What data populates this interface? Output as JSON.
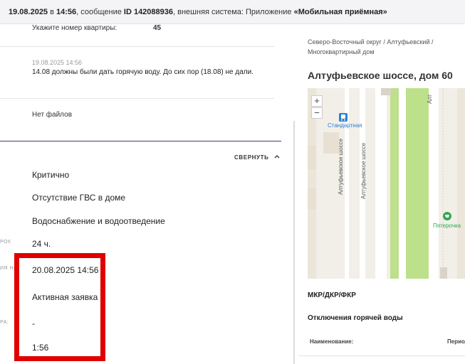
{
  "header": {
    "date": "19.08.2025",
    "in_word": " в ",
    "time": "14:56",
    "msg_prefix": ", сообщение ",
    "msg_id": "ID 142088936",
    "system_prefix": ", внешняя система: Приложение ",
    "app_name": "«Мобильная приёмная»"
  },
  "question": {
    "label": "Укажите номер квартиры:",
    "value": "45"
  },
  "comment": {
    "timestamp": "19.08.2025 14:56",
    "text": "14.08 должны были дать горячую воду. До сих пор (18.08) не дали."
  },
  "files": {
    "empty": "Нет файлов"
  },
  "details": {
    "collapse_label": "СВЕРНУТЬ",
    "priority": "Критично",
    "category": "Отсутствие ГВС в доме",
    "subcategory": "Водоснабжение и водоотведение",
    "cut_label_1": "РОК",
    "term": "24 ч.",
    "cut_label_2": "ИЯ НА",
    "created": "20.08.2025 14:56",
    "status": "Активная заявка",
    "cut_label_3": "РА:",
    "dash": "-",
    "duration": "1:56"
  },
  "right": {
    "breadcrumb_line1": "Северо-Восточный округ / Алтуфьевский /",
    "breadcrumb_line2": "Многоквартирный дом",
    "address": "Алтуфьевское шоссе, дом 60",
    "map": {
      "zoom_in": "+",
      "zoom_out": "−",
      "stop_name": "Стандартная",
      "road_label_1": "Алтуфьевское шоссе",
      "road_label_2": "Алтуфьевское шоссе",
      "shop_name": "Пятерочка",
      "road_label_3": "Алт"
    },
    "section_mkr": "МКР/ДКР/ФКР",
    "section_outages": "Отключения горячей воды",
    "table_col_name": "Наименование:",
    "table_col_period": "Период"
  }
}
